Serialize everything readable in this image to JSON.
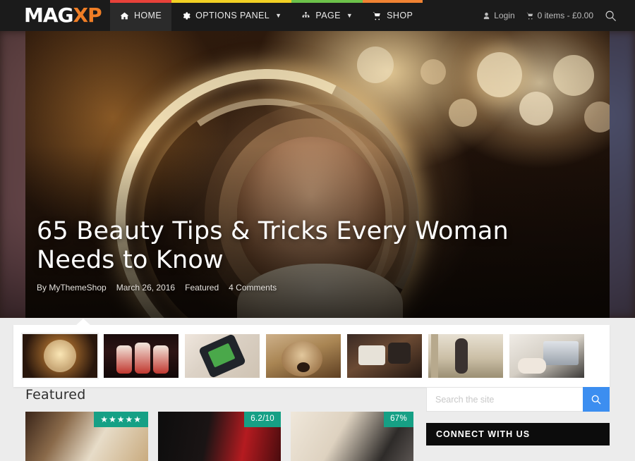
{
  "site": {
    "logo_primary": "MAG",
    "logo_accent": "XP",
    "accent_color": "#f07e26"
  },
  "nav": {
    "items": [
      {
        "label": "Home",
        "icon": "home-icon",
        "caret": false,
        "active": true,
        "bar_color": "#e8413a"
      },
      {
        "label": "Options Panel",
        "icon": "gear-icon",
        "caret": true,
        "active": false,
        "bar_color": "#f2d024"
      },
      {
        "label": "Page",
        "icon": "sitemap-icon",
        "caret": true,
        "active": false,
        "bar_color": "#6cc24a"
      },
      {
        "label": "Shop",
        "icon": "cart-icon",
        "caret": false,
        "active": false,
        "bar_color": "#f08232"
      }
    ]
  },
  "header_right": {
    "login_label": "Login",
    "login_icon": "user-icon",
    "cart_label": "0 items - £0.00",
    "cart_icon": "cart-icon",
    "search_icon": "search-icon"
  },
  "hero": {
    "title": "65 Beauty Tips & Tricks Every Woman Needs to Know",
    "meta": {
      "author": "By MyThemeShop",
      "date": "March 26, 2016",
      "category": "Featured",
      "comments": "4 Comments"
    }
  },
  "thumbnail_strip": {
    "count": 7,
    "selected_index": 0,
    "items": [
      {
        "name": "thumb-light-trail-portrait"
      },
      {
        "name": "thumb-parfait-desserts"
      },
      {
        "name": "thumb-hand-holding-phone"
      },
      {
        "name": "thumb-golden-retriever-dog"
      },
      {
        "name": "thumb-vintage-camera-flatlay"
      },
      {
        "name": "thumb-woman-by-window"
      },
      {
        "name": "thumb-laptop-workspace"
      }
    ]
  },
  "featured": {
    "heading": "Featured",
    "cards": [
      {
        "name": "featured-card-1",
        "badge_type": "stars",
        "badge_text": "★★★★★"
      },
      {
        "name": "featured-card-2",
        "badge_type": "score",
        "badge_text": "6.2/10"
      },
      {
        "name": "featured-card-3",
        "badge_type": "percent",
        "badge_text": "67%"
      }
    ],
    "badge_color": "#16a085"
  },
  "sidebar": {
    "search": {
      "placeholder": "Search the site",
      "value": "",
      "button_icon": "search-icon",
      "button_color": "#3c8ef0"
    },
    "widget": {
      "title": "Connect With Us"
    }
  }
}
